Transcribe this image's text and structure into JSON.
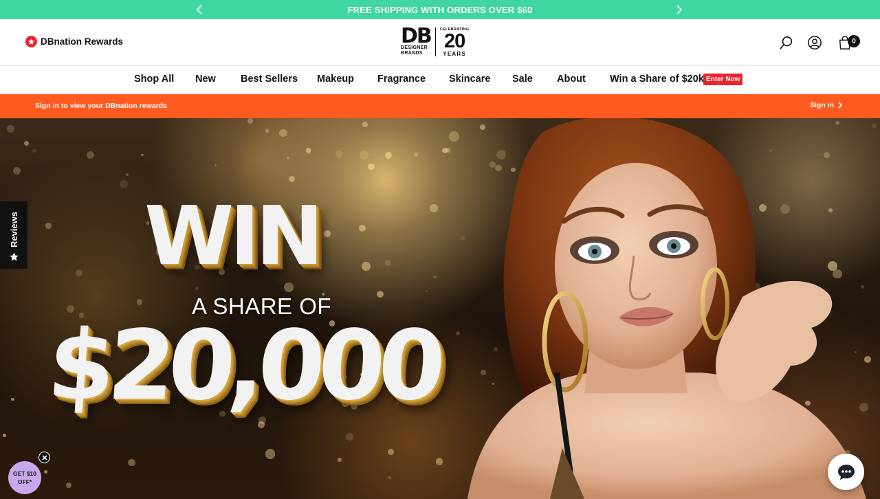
{
  "announcement": {
    "message": "FREE SHIPPING WITH ORDERS OVER $60",
    "prev_icon": "chevron-left-icon",
    "next_icon": "chevron-right-icon"
  },
  "header": {
    "rewards_label": "DBnation Rewards",
    "logo": {
      "letters": "DB",
      "line1": "DESIGNER",
      "line2": "BRANDS",
      "celebrating": "CELEBRATING",
      "number": "20",
      "years": "YEARS"
    },
    "cart_count": "0"
  },
  "nav": {
    "items": [
      "Shop All",
      "New",
      "Best Sellers",
      "Makeup",
      "Fragrance",
      "Skincare",
      "Sale",
      "About",
      "Win a Share of $20k"
    ],
    "badge": "Enter Now"
  },
  "signin_bar": {
    "message": "Sign in to view your DBnation rewards",
    "link": "Sign in"
  },
  "hero": {
    "win": "WIN",
    "share": "A SHARE OF",
    "amount": "$20,000"
  },
  "reviews_tab": {
    "label": "Reviews"
  },
  "discount": {
    "line1": "GET $10",
    "line2": "OFF*"
  },
  "colors": {
    "announce": "#3fd6a0",
    "signin_bar": "#ff5a1f",
    "badge": "#e8262f",
    "discount": "#c9a8f0"
  }
}
